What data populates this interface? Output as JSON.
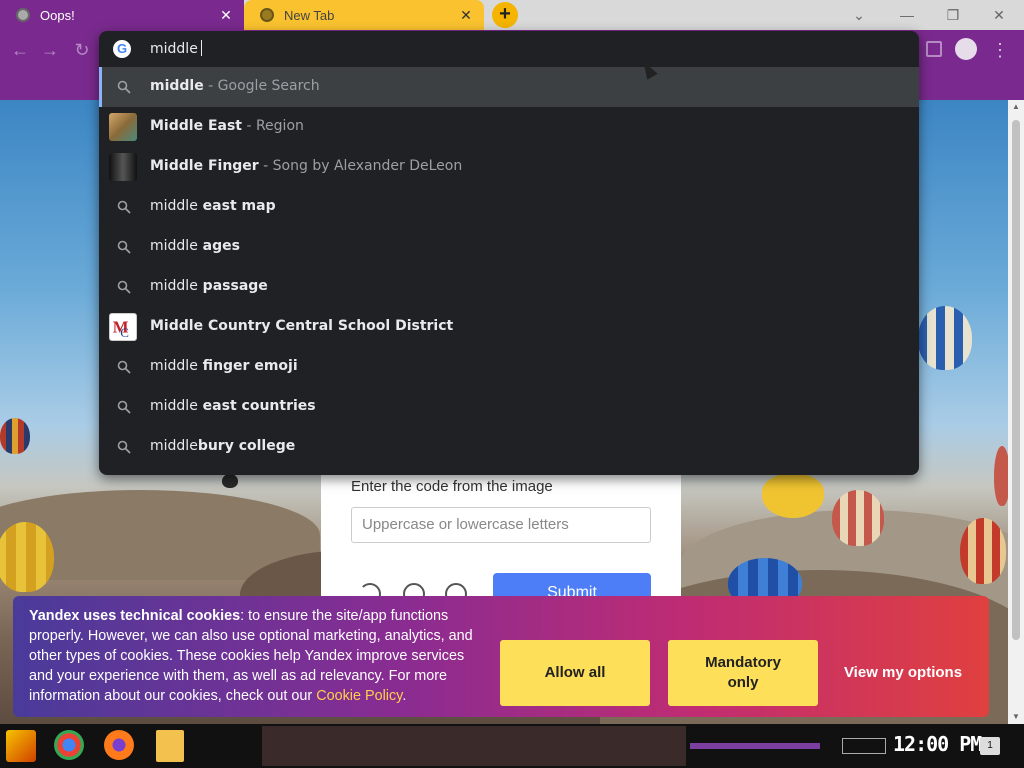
{
  "tabs": [
    {
      "title": "Oops!",
      "active": false
    },
    {
      "title": "New Tab",
      "active": true
    }
  ],
  "new_tab_symbol": "+",
  "window_controls": {
    "chevron": "⌄",
    "minimize": "—",
    "restore": "❐",
    "close": "✕"
  },
  "toolbar": {
    "back": "←",
    "forward": "→",
    "reload": "↻",
    "menu": "⋮"
  },
  "omnibox": {
    "query": "middle",
    "suggestions": [
      {
        "type": "search",
        "bold": "middle",
        "rest": "",
        "desc": " - Google Search",
        "icon": "search-icon"
      },
      {
        "type": "entity",
        "bold": "Middle",
        "rest": " East",
        "desc": " - Region",
        "icon": "thumbnail"
      },
      {
        "type": "entity",
        "bold": "Middle",
        "rest": " Finger",
        "desc": " - Song by Alexander DeLeon",
        "icon": "thumbnail"
      },
      {
        "type": "search",
        "bold": "middle",
        "rest": " east map",
        "desc": "",
        "icon": "search-icon"
      },
      {
        "type": "search",
        "bold": "middle",
        "rest": " ages",
        "desc": "",
        "icon": "search-icon"
      },
      {
        "type": "search",
        "bold": "middle",
        "rest": " passage",
        "desc": "",
        "icon": "search-icon"
      },
      {
        "type": "entity",
        "bold": "Middle",
        "rest": " Country Central School District",
        "desc": "",
        "icon": "logo"
      },
      {
        "type": "search",
        "bold": "middle",
        "rest": " finger emoji",
        "desc": "",
        "icon": "search-icon"
      },
      {
        "type": "search",
        "bold": "middle",
        "rest": " east countries",
        "desc": "",
        "icon": "search-icon"
      },
      {
        "type": "search",
        "bold": "middle",
        "rest": "bury college",
        "desc": "",
        "icon": "search-icon"
      }
    ]
  },
  "captcha": {
    "label": "Enter the code from the image",
    "placeholder": "Uppercase or lowercase letters",
    "submit": "Submit"
  },
  "cookie_banner": {
    "bold": "Yandex uses technical cookies",
    "text": ": to ensure the site/app functions properly. However, we can also use optional marketing, analytics, and other types of cookies. These cookies help Yandex improve services and your experience with them, as well as ad relevancy. For more information about our cookies, check out our ",
    "link": "Cookie Policy",
    "end": ".",
    "buttons": {
      "allow_all": "Allow all",
      "mandatory": "Mandatory only",
      "view_options": "View my options"
    }
  },
  "taskbar": {
    "clock": "12:00 PM",
    "notification_count": "1"
  },
  "colors": {
    "accent_purple": "#7a2a8e",
    "tab_yellow": "#f9c22e",
    "omnibox_bg": "#202124",
    "submit_blue": "#4d7ef7",
    "cookie_button": "#fedf5a",
    "cookie_link": "#ffcf4b"
  }
}
